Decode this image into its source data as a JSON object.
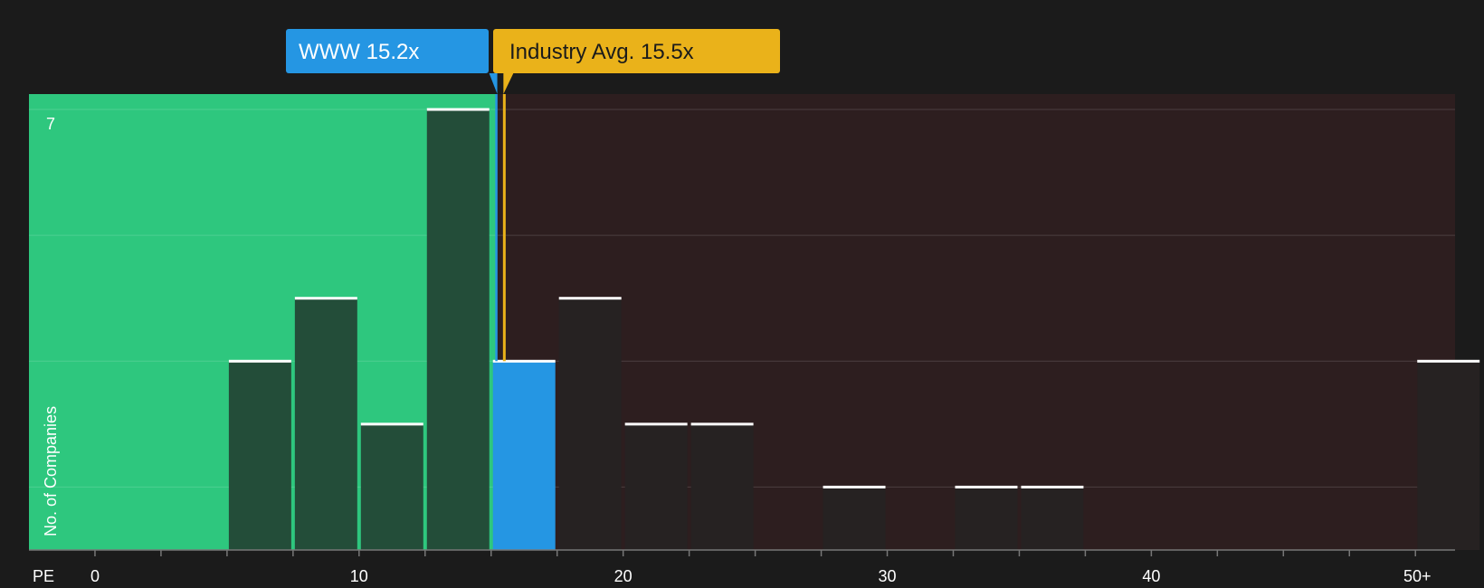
{
  "colors": {
    "background": "#1b1b1b",
    "undervalued_zone": "#2ec77e",
    "overvalued_zone": "#2d1e1f",
    "bar_in_green": "#234d39",
    "bar_in_red": "#262222",
    "company_bar": "#2596e3",
    "company_line": "#2596e3",
    "industry_line": "#eab21a",
    "bar_cap": "#ffffff"
  },
  "chart_data": {
    "type": "bar",
    "title": "",
    "xlabel": "PE",
    "ylabel": "No. of Companies",
    "xlim": [
      -2.5,
      51.5
    ],
    "ylim": [
      0,
      7.25
    ],
    "bin_width": 2.5,
    "x_ticks": [
      0,
      10,
      20,
      30,
      40,
      50
    ],
    "x_tick_labels": [
      "0",
      "10",
      "20",
      "30",
      "40",
      "50+"
    ],
    "y_ticks": [
      1,
      2,
      3,
      4,
      5,
      6,
      7
    ],
    "y_tick_labels": [
      "7"
    ],
    "bins": [
      {
        "x": 5,
        "value": 3
      },
      {
        "x": 7.5,
        "value": 4
      },
      {
        "x": 10,
        "value": 2
      },
      {
        "x": 12.5,
        "value": 7
      },
      {
        "x": 15,
        "value": 3,
        "highlight": true
      },
      {
        "x": 17.5,
        "value": 4
      },
      {
        "x": 20,
        "value": 2
      },
      {
        "x": 22.5,
        "value": 2
      },
      {
        "x": 27.5,
        "value": 1
      },
      {
        "x": 32.5,
        "value": 1
      },
      {
        "x": 35,
        "value": 1
      },
      {
        "x": 50,
        "value": 3
      }
    ],
    "company": {
      "label": "WWW 15.2x",
      "value": 15.2
    },
    "industry": {
      "label": "Industry Avg. 15.5x",
      "value": 15.5
    }
  }
}
